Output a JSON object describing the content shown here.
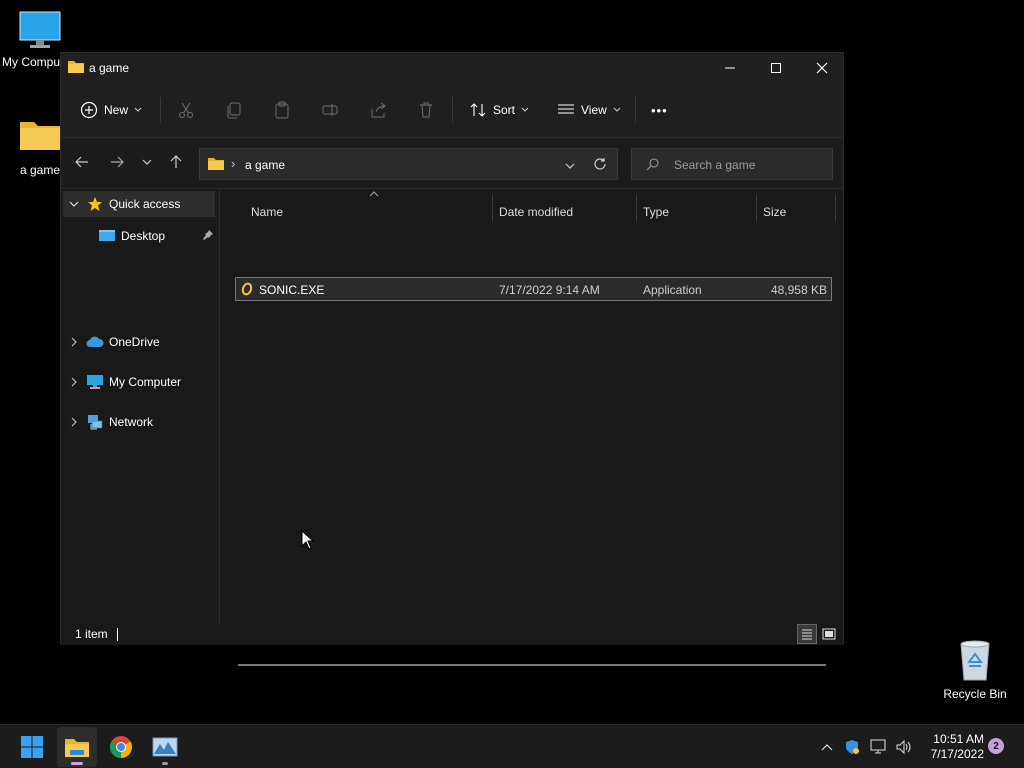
{
  "desktop": {
    "icons": [
      {
        "label": "My Compu"
      },
      {
        "label": "a game"
      },
      {
        "label": "Recycle Bin"
      }
    ]
  },
  "window": {
    "title": "a game",
    "controls": {
      "minimize": "minimize-icon",
      "maximize": "maximize-icon",
      "close": "close-icon"
    }
  },
  "toolbar": {
    "new_label": "New",
    "sort_label": "Sort",
    "view_label": "View",
    "more_label": "•••",
    "disabled_actions": [
      "cut-icon",
      "copy-icon",
      "paste-icon",
      "rename-icon",
      "share-icon",
      "delete-icon"
    ]
  },
  "address": {
    "breadcrumb_separator": "›",
    "breadcrumb": "a game"
  },
  "search": {
    "placeholder": "Search a game"
  },
  "navpane": {
    "items": [
      {
        "label": "Quick access",
        "icon": "star-icon",
        "expanded": true,
        "selected": true
      },
      {
        "label": "Desktop",
        "icon": "desktop-icon",
        "pinned": true
      },
      {
        "label": "OneDrive",
        "icon": "cloud-icon"
      },
      {
        "label": "My Computer",
        "icon": "computer-icon"
      },
      {
        "label": "Network",
        "icon": "network-icon"
      }
    ]
  },
  "files": {
    "columns": [
      "Name",
      "Date modified",
      "Type",
      "Size"
    ],
    "rows": [
      {
        "name": "SONIC.EXE",
        "date": "7/17/2022 9:14 AM",
        "type": "Application",
        "size": "48,958 KB"
      }
    ]
  },
  "status": {
    "item_count": "1 item"
  },
  "taskbar": {
    "apps": [
      "start-icon",
      "file-explorer-icon",
      "chrome-icon",
      "photo-app-icon"
    ],
    "time": "10:51 AM",
    "date": "7/17/2022",
    "notification_count": "2"
  },
  "colors": {
    "window_bg": "#191919",
    "titlebar_bg": "#202020",
    "folder_yellow": "#f4c542",
    "accent_blue": "#4aa0e6"
  }
}
